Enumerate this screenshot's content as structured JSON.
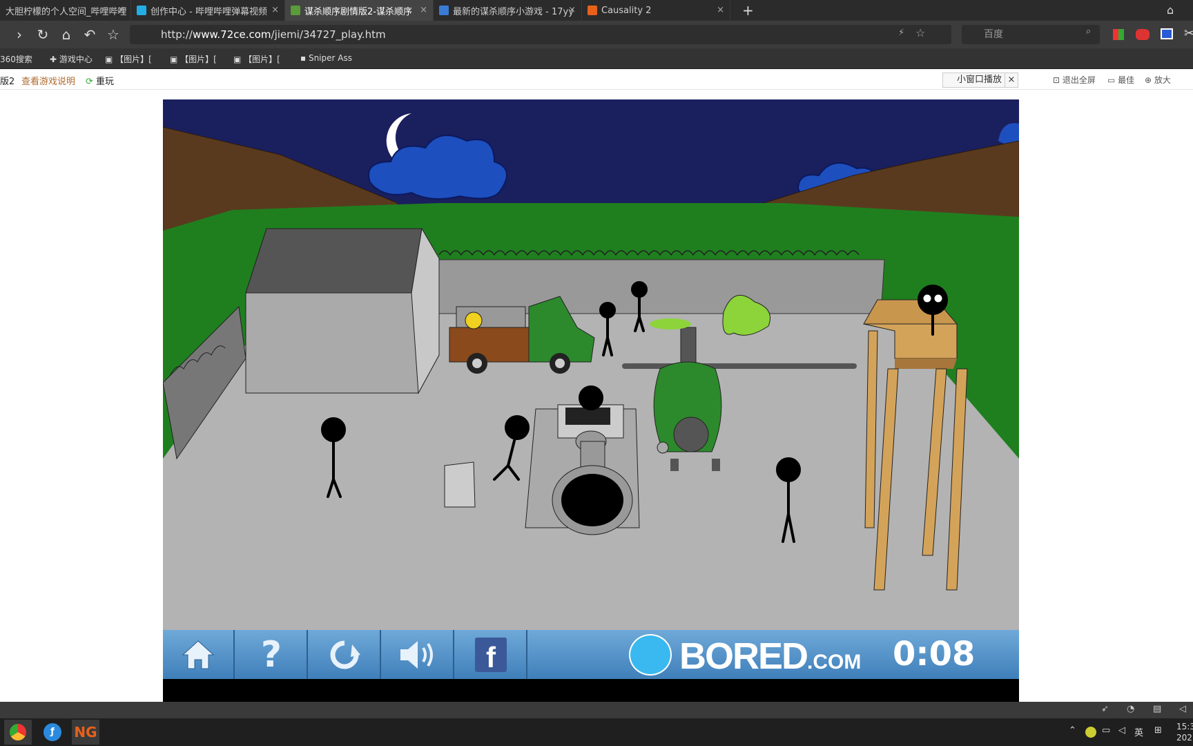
{
  "tabs": [
    {
      "title": "大胆柠檬的个人空间_哔哩哔哩",
      "active": false
    },
    {
      "title": "创作中心 - 哔哩哔哩弹幕视频",
      "active": false
    },
    {
      "title": "谋杀顺序剧情版2-谋杀顺序",
      "active": true
    },
    {
      "title": "最新的谋杀顺序小游戏 - 17yy",
      "active": false
    },
    {
      "title": "Causality 2",
      "active": false
    }
  ],
  "nav": {
    "url_prefix": "http://",
    "url_host": "www.72ce.com",
    "url_path": "/jiemi/34727_play.htm",
    "search_placeholder": "百度"
  },
  "bookmarks": [
    "360搜索",
    "游戏中心",
    "【图片】[",
    "【图片】[",
    "【图片】[",
    "Sniper Ass"
  ],
  "pagebar": {
    "game_title": "版2",
    "instructions_link": "查看游戏说明",
    "replay": "重玩",
    "mini_window": "小窗口播放",
    "exit_fullscreen": "退出全屏",
    "best": "最佳",
    "zoom": "放大"
  },
  "hud": {
    "brand_main": "BORED",
    "brand_suffix": ".COM",
    "timer": "0:08",
    "buttons": [
      "home-icon",
      "help-icon",
      "restart-icon",
      "sound-icon",
      "facebook-icon"
    ]
  },
  "taskbar": {
    "tray_lang": "英",
    "clock": "15:3",
    "date": "202"
  },
  "colors": {
    "sky": "#1a1f5e",
    "grass": "#1f7f1f",
    "ground": "#b3b3b3",
    "hud_blue": "#4d8cc7"
  }
}
